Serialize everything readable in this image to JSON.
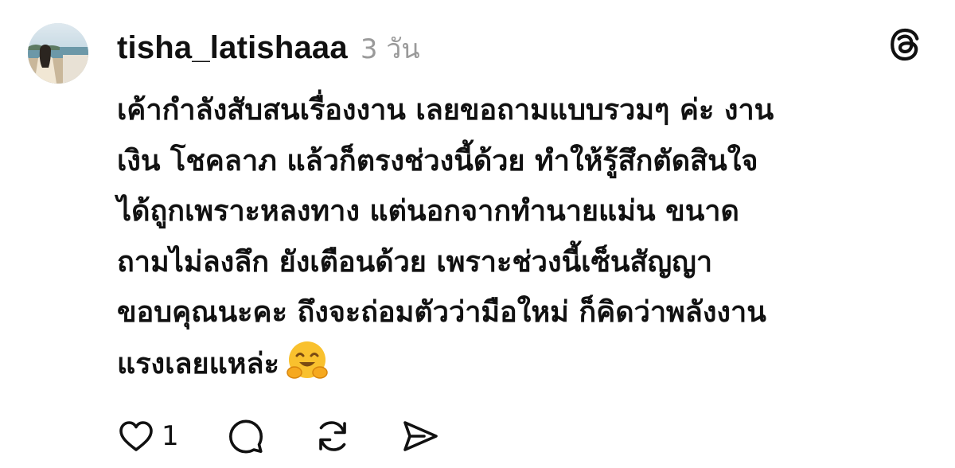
{
  "post": {
    "username": "tisha_latishaaa",
    "time": "3 วัน",
    "body_lines": [
      "เค้ากำลังสับสนเรื่องงาน เลยขอถามแบบรวมๆ ค่ะ งาน",
      "เงิน โชคลาภ แล้วก็ตรงช่วงนี้ด้วย ทำให้รู้สึกตัดสินใจ",
      "ได้ถูกเพราะหลงทาง แต่นอกจากทำนายแม่น ขนาด",
      "ถามไม่ลงลึก ยังเตือนด้วย เพราะช่วงนี้เซ็นสัญญา",
      "ขอบคุณนะคะ ถึงจะถ่อมตัวว่ามือใหม่ ก็คิดว่าพลังงาน",
      "แรงเลยแหล่ะ"
    ],
    "emoji": "hugging-face-emoji",
    "like_count": "1"
  },
  "icons": {
    "logo": "threads-logo-icon",
    "like": "heart-icon",
    "reply": "comment-icon",
    "repost": "repost-icon",
    "share": "send-icon"
  },
  "colors": {
    "text": "#111111",
    "muted": "#9a9a9a",
    "emoji": "#f9c12e"
  }
}
